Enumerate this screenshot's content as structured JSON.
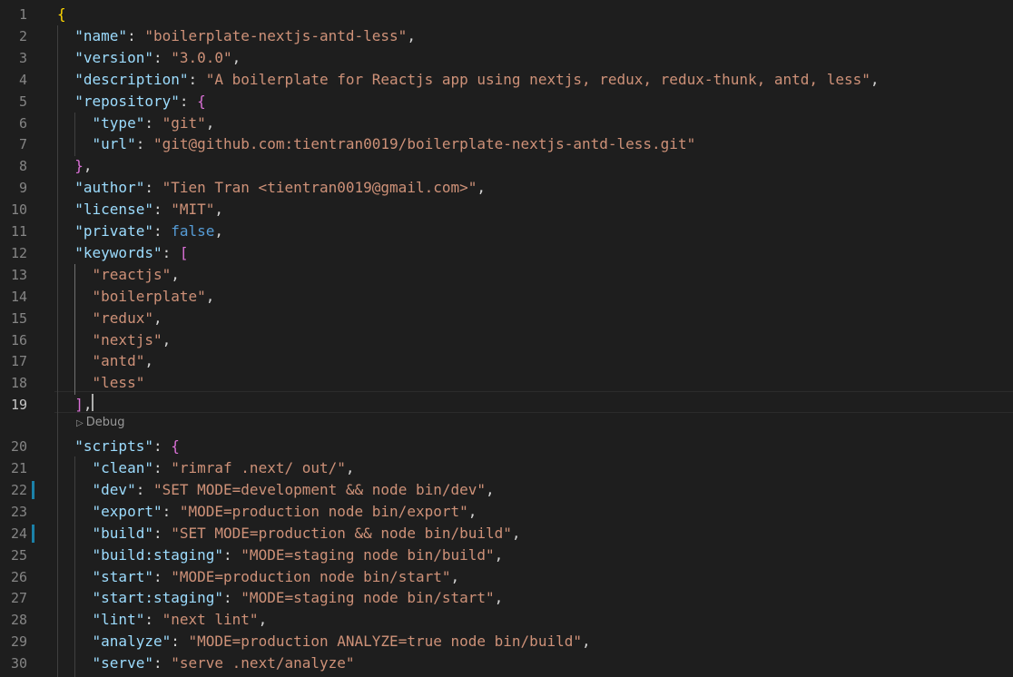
{
  "editor": {
    "line_numbers": [
      "1",
      "2",
      "3",
      "4",
      "5",
      "6",
      "7",
      "8",
      "9",
      "10",
      "11",
      "12",
      "13",
      "14",
      "15",
      "16",
      "17",
      "18",
      "19",
      "20",
      "21",
      "22",
      "23",
      "24",
      "25",
      "26",
      "27",
      "28",
      "29",
      "30"
    ],
    "lines": [
      [
        {
          "t": "{",
          "c": "b1"
        }
      ],
      [
        {
          "t": "  ",
          "c": "p"
        },
        {
          "t": "\"name\"",
          "c": "k"
        },
        {
          "t": ": ",
          "c": "p"
        },
        {
          "t": "\"boilerplate-nextjs-antd-less\"",
          "c": "s"
        },
        {
          "t": ",",
          "c": "p"
        }
      ],
      [
        {
          "t": "  ",
          "c": "p"
        },
        {
          "t": "\"version\"",
          "c": "k"
        },
        {
          "t": ": ",
          "c": "p"
        },
        {
          "t": "\"3.0.0\"",
          "c": "s"
        },
        {
          "t": ",",
          "c": "p"
        }
      ],
      [
        {
          "t": "  ",
          "c": "p"
        },
        {
          "t": "\"description\"",
          "c": "k"
        },
        {
          "t": ": ",
          "c": "p"
        },
        {
          "t": "\"A boilerplate for Reactjs app using nextjs, redux, redux-thunk, antd, less\"",
          "c": "s"
        },
        {
          "t": ",",
          "c": "p"
        }
      ],
      [
        {
          "t": "  ",
          "c": "p"
        },
        {
          "t": "\"repository\"",
          "c": "k"
        },
        {
          "t": ": ",
          "c": "p"
        },
        {
          "t": "{",
          "c": "b2"
        }
      ],
      [
        {
          "t": "    ",
          "c": "p"
        },
        {
          "t": "\"type\"",
          "c": "k"
        },
        {
          "t": ": ",
          "c": "p"
        },
        {
          "t": "\"git\"",
          "c": "s"
        },
        {
          "t": ",",
          "c": "p"
        }
      ],
      [
        {
          "t": "    ",
          "c": "p"
        },
        {
          "t": "\"url\"",
          "c": "k"
        },
        {
          "t": ": ",
          "c": "p"
        },
        {
          "t": "\"git@github.com:tientran0019/boilerplate-nextjs-antd-less.git\"",
          "c": "s"
        }
      ],
      [
        {
          "t": "  ",
          "c": "p"
        },
        {
          "t": "}",
          "c": "b2"
        },
        {
          "t": ",",
          "c": "p"
        }
      ],
      [
        {
          "t": "  ",
          "c": "p"
        },
        {
          "t": "\"author\"",
          "c": "k"
        },
        {
          "t": ": ",
          "c": "p"
        },
        {
          "t": "\"Tien Tran <tientran0019@gmail.com>\"",
          "c": "s"
        },
        {
          "t": ",",
          "c": "p"
        }
      ],
      [
        {
          "t": "  ",
          "c": "p"
        },
        {
          "t": "\"license\"",
          "c": "k"
        },
        {
          "t": ": ",
          "c": "p"
        },
        {
          "t": "\"MIT\"",
          "c": "s"
        },
        {
          "t": ",",
          "c": "p"
        }
      ],
      [
        {
          "t": "  ",
          "c": "p"
        },
        {
          "t": "\"private\"",
          "c": "k"
        },
        {
          "t": ": ",
          "c": "p"
        },
        {
          "t": "false",
          "c": "kw"
        },
        {
          "t": ",",
          "c": "p"
        }
      ],
      [
        {
          "t": "  ",
          "c": "p"
        },
        {
          "t": "\"keywords\"",
          "c": "k"
        },
        {
          "t": ": ",
          "c": "p"
        },
        {
          "t": "[",
          "c": "b2"
        }
      ],
      [
        {
          "t": "    ",
          "c": "p"
        },
        {
          "t": "\"reactjs\"",
          "c": "s"
        },
        {
          "t": ",",
          "c": "p"
        }
      ],
      [
        {
          "t": "    ",
          "c": "p"
        },
        {
          "t": "\"boilerplate\"",
          "c": "s"
        },
        {
          "t": ",",
          "c": "p"
        }
      ],
      [
        {
          "t": "    ",
          "c": "p"
        },
        {
          "t": "\"redux\"",
          "c": "s"
        },
        {
          "t": ",",
          "c": "p"
        }
      ],
      [
        {
          "t": "    ",
          "c": "p"
        },
        {
          "t": "\"nextjs\"",
          "c": "s"
        },
        {
          "t": ",",
          "c": "p"
        }
      ],
      [
        {
          "t": "    ",
          "c": "p"
        },
        {
          "t": "\"antd\"",
          "c": "s"
        },
        {
          "t": ",",
          "c": "p"
        }
      ],
      [
        {
          "t": "    ",
          "c": "p"
        },
        {
          "t": "\"less\"",
          "c": "s"
        }
      ],
      [
        {
          "t": "  ",
          "c": "p"
        },
        {
          "t": "]",
          "c": "b2"
        },
        {
          "t": ",",
          "c": "p"
        }
      ],
      [
        {
          "t": "  ",
          "c": "p"
        },
        {
          "t": "\"scripts\"",
          "c": "k"
        },
        {
          "t": ": ",
          "c": "p"
        },
        {
          "t": "{",
          "c": "b2"
        }
      ],
      [
        {
          "t": "    ",
          "c": "p"
        },
        {
          "t": "\"clean\"",
          "c": "k"
        },
        {
          "t": ": ",
          "c": "p"
        },
        {
          "t": "\"rimraf .next/ out/\"",
          "c": "s"
        },
        {
          "t": ",",
          "c": "p"
        }
      ],
      [
        {
          "t": "    ",
          "c": "p"
        },
        {
          "t": "\"dev\"",
          "c": "k"
        },
        {
          "t": ": ",
          "c": "p"
        },
        {
          "t": "\"SET MODE=development && node bin/dev\"",
          "c": "s"
        },
        {
          "t": ",",
          "c": "p"
        }
      ],
      [
        {
          "t": "    ",
          "c": "p"
        },
        {
          "t": "\"export\"",
          "c": "k"
        },
        {
          "t": ": ",
          "c": "p"
        },
        {
          "t": "\"MODE=production node bin/export\"",
          "c": "s"
        },
        {
          "t": ",",
          "c": "p"
        }
      ],
      [
        {
          "t": "    ",
          "c": "p"
        },
        {
          "t": "\"build\"",
          "c": "k"
        },
        {
          "t": ": ",
          "c": "p"
        },
        {
          "t": "\"SET MODE=production && node bin/build\"",
          "c": "s"
        },
        {
          "t": ",",
          "c": "p"
        }
      ],
      [
        {
          "t": "    ",
          "c": "p"
        },
        {
          "t": "\"build:staging\"",
          "c": "k"
        },
        {
          "t": ": ",
          "c": "p"
        },
        {
          "t": "\"MODE=staging node bin/build\"",
          "c": "s"
        },
        {
          "t": ",",
          "c": "p"
        }
      ],
      [
        {
          "t": "    ",
          "c": "p"
        },
        {
          "t": "\"start\"",
          "c": "k"
        },
        {
          "t": ": ",
          "c": "p"
        },
        {
          "t": "\"MODE=production node bin/start\"",
          "c": "s"
        },
        {
          "t": ",",
          "c": "p"
        }
      ],
      [
        {
          "t": "    ",
          "c": "p"
        },
        {
          "t": "\"start:staging\"",
          "c": "k"
        },
        {
          "t": ": ",
          "c": "p"
        },
        {
          "t": "\"MODE=staging node bin/start\"",
          "c": "s"
        },
        {
          "t": ",",
          "c": "p"
        }
      ],
      [
        {
          "t": "    ",
          "c": "p"
        },
        {
          "t": "\"lint\"",
          "c": "k"
        },
        {
          "t": ": ",
          "c": "p"
        },
        {
          "t": "\"next lint\"",
          "c": "s"
        },
        {
          "t": ",",
          "c": "p"
        }
      ],
      [
        {
          "t": "    ",
          "c": "p"
        },
        {
          "t": "\"analyze\"",
          "c": "k"
        },
        {
          "t": ": ",
          "c": "p"
        },
        {
          "t": "\"MODE=production ANALYZE=true node bin/build\"",
          "c": "s"
        },
        {
          "t": ",",
          "c": "p"
        }
      ],
      [
        {
          "t": "    ",
          "c": "p"
        },
        {
          "t": "\"serve\"",
          "c": "k"
        },
        {
          "t": ": ",
          "c": "p"
        },
        {
          "t": "\"serve .next/analyze\"",
          "c": "s"
        }
      ]
    ],
    "active_line": "19",
    "modified_lines": [
      "22",
      "24"
    ],
    "codelens_label": "Debug",
    "colors": {
      "background": "#1e1e1e",
      "key": "#9cdcfe",
      "string": "#ce9178",
      "keyword": "#569cd6",
      "bracket_level1": "#ffd700",
      "bracket_level2": "#da70d6",
      "modified_gutter": "#1b81a8"
    },
    "icons": {
      "codelens": "run-triangle-icon"
    }
  }
}
